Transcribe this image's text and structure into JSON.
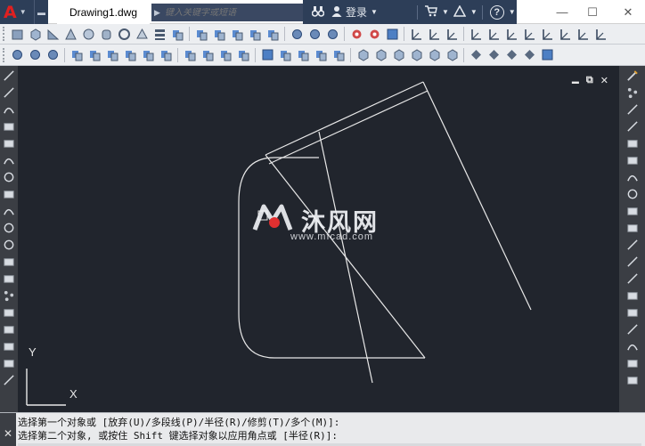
{
  "titlebar": {
    "app_logo": "A",
    "document_tab": "Drawing1.dwg",
    "search_placeholder": "键入关键字或短语",
    "login_label": "登录",
    "help_label": "?",
    "minimize": "—",
    "maximize": "☐",
    "close": "✕"
  },
  "canvas": {
    "controls": {
      "minimize": "▬",
      "restore": "⧉",
      "close": "✕"
    },
    "ucs": {
      "x_label": "X",
      "y_label": "Y"
    },
    "watermark": {
      "brand": "沐风网",
      "url": "www.mfcad.com"
    }
  },
  "command_line": {
    "close_label": "✕",
    "line1": "选择第一个对象或 [放弃(U)/多段线(P)/半径(R)/修剪(T)/多个(M)]:",
    "line2": "选择第二个对象, 或按住 Shift 键选择对象以应用角点或 [半径(R)]:"
  },
  "colors": {
    "canvas_bg": "#21252d",
    "title_dark": "#2d3e58",
    "logo_red": "#e02020",
    "toolbar_bg": "#eceef1",
    "line_color": "#e8e8e8"
  }
}
